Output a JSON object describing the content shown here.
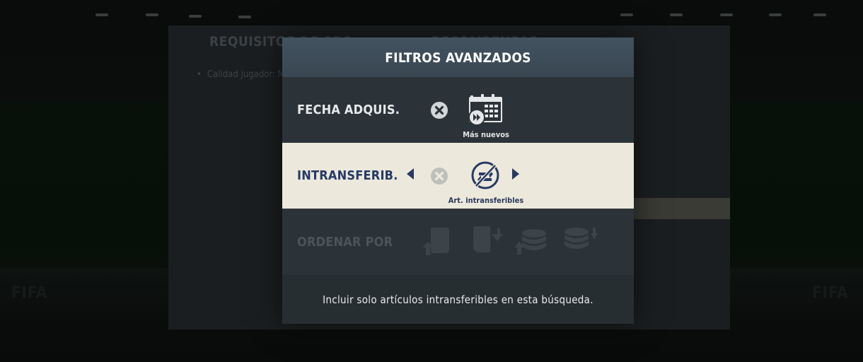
{
  "background": {
    "panel_left_header": "REQUISITOS DE SBC",
    "panel_right_header": "RECOMPENSAS",
    "requirement": "Calidad jugador: Mín."
  },
  "modal": {
    "title": "FILTROS AVANZADOS",
    "rows": [
      {
        "label": "FECHA ADQUIS.",
        "caption": "Más nuevos",
        "icon": "calendar-fast-forward-icon"
      },
      {
        "label": "INTRANSFERIB.",
        "caption": "Art. intransferibles",
        "icon": "untradeable-icon"
      },
      {
        "label": "ORDENAR POR",
        "icons": [
          "sort-ascending-card-icon",
          "sort-descending-card-icon",
          "sort-ascending-coins-icon",
          "sort-descending-coins-icon"
        ]
      }
    ],
    "info_text": "Incluir solo artículos intransferibles en esta búsqueda."
  },
  "colors": {
    "modal_bg": "#2c3338",
    "title_bar": "#3e4c58",
    "selected_row_bg": "#ece9dc",
    "selected_text": "#263a66",
    "disabled_text": "#4b5459"
  }
}
